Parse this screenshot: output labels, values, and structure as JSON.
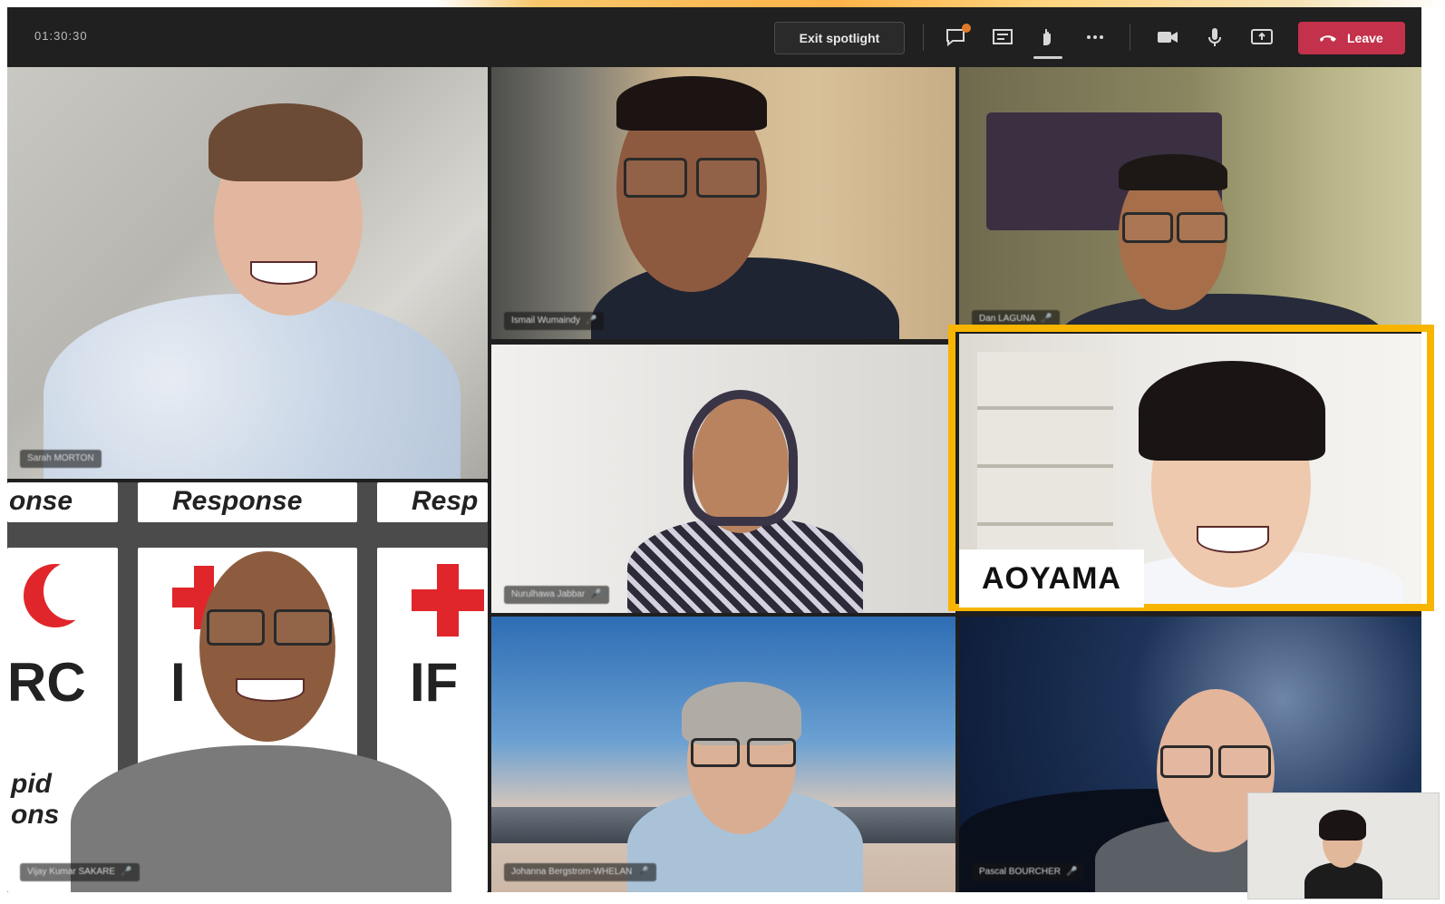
{
  "toolbar": {
    "timer": "01:30:30",
    "exit_spotlight_label": "Exit spotlight",
    "leave_label": "Leave",
    "icons": [
      "chat-icon",
      "participants-icon",
      "raise-hand-icon",
      "more-icon",
      "camera-icon",
      "mic-icon",
      "share-screen-icon",
      "hang-up-icon"
    ]
  },
  "participants": [
    {
      "name": "Sarah MORTON",
      "tile": "top-left"
    },
    {
      "name": "Ismail Wumaindy",
      "tile": "top-middle"
    },
    {
      "name": "Dan LAGUNA",
      "tile": "top-right"
    },
    {
      "name": "Nurulhawa Jabbar",
      "tile": "middle-center"
    },
    {
      "name": "Vijay Kumar SAKARE",
      "tile": "bottom-left"
    },
    {
      "name": "Johanna Bergstrom-WHELAN",
      "tile": "bottom-middle"
    },
    {
      "name": "Pascal BOURCHER",
      "tile": "bottom-right"
    }
  ],
  "highlight": {
    "label": "AOYAMA",
    "color": "#f7b500"
  },
  "banner": {
    "words": [
      "onse",
      "Response",
      "Resp"
    ],
    "letters": [
      "RC",
      "I",
      "IF"
    ],
    "lower": [
      "pid",
      "ons"
    ]
  },
  "colors": {
    "leave": "#c4314b",
    "toolbar": "#202020",
    "accent": "#f7b500"
  }
}
